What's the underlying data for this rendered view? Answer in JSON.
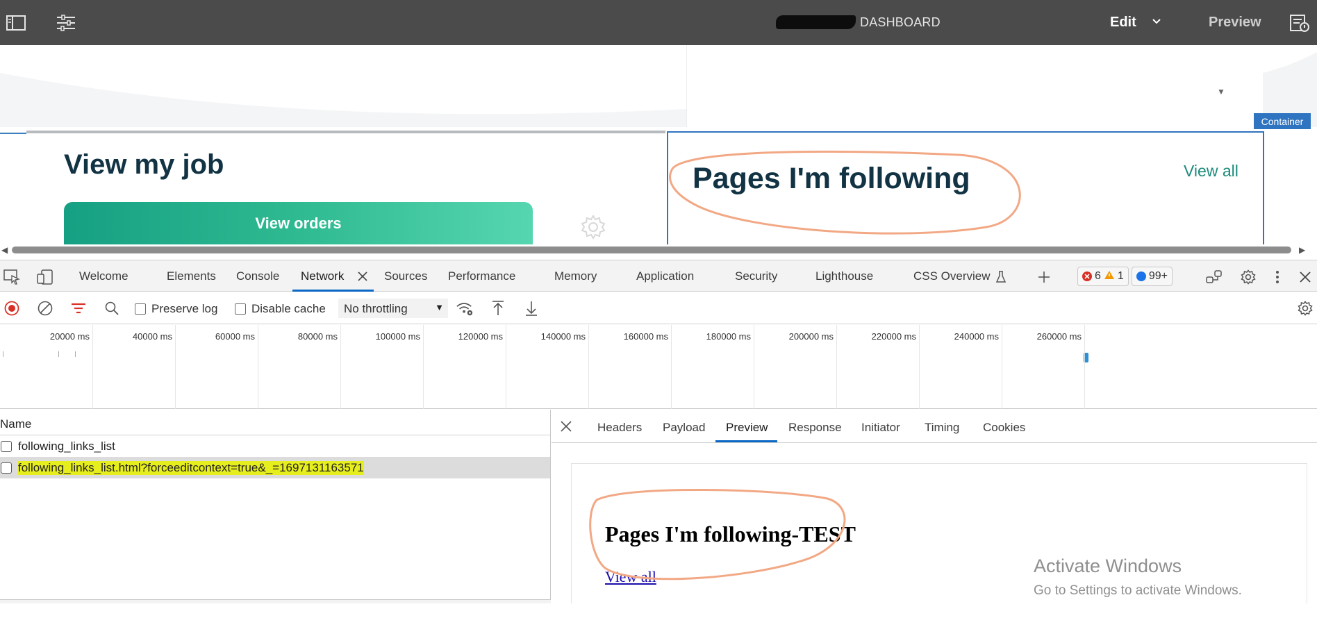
{
  "topbar": {
    "title": "DASHBOARD",
    "edit_label": "Edit",
    "preview_label": "Preview",
    "icons": [
      "sidebar-panel-icon",
      "properties-sliders-icon",
      "chevron-down-icon",
      "page-info-icon"
    ]
  },
  "page": {
    "container_badge": "Container",
    "job_title": "View my job",
    "orders_button": "View orders",
    "pages_title": "Pages I'm following",
    "view_all": "View all",
    "brand_color": "#1fa888",
    "title_color": "#123344",
    "annotation_color": "#f2a884"
  },
  "devtools": {
    "tabs": [
      {
        "label": "Welcome"
      },
      {
        "label": "Elements"
      },
      {
        "label": "Console"
      },
      {
        "label": "Network",
        "active": true
      },
      {
        "label": "Sources"
      },
      {
        "label": "Performance"
      },
      {
        "label": "Memory"
      },
      {
        "label": "Application"
      },
      {
        "label": "Security"
      },
      {
        "label": "Lighthouse"
      },
      {
        "label": "CSS Overview"
      }
    ],
    "errors": "6",
    "warnings": "1",
    "messages": "99+",
    "accent": "#0b67c5"
  },
  "network": {
    "preserve_log": "Preserve log",
    "disable_cache": "Disable cache",
    "throttling": "No throttling",
    "preserve_log_checked": false,
    "disable_cache_checked": false
  },
  "timeline": {
    "ticks": [
      "20000 ms",
      "40000 ms",
      "60000 ms",
      "80000 ms",
      "100000 ms",
      "120000 ms",
      "140000 ms",
      "160000 ms",
      "180000 ms",
      "200000 ms",
      "220000 ms",
      "240000 ms",
      "260000 ms"
    ]
  },
  "requests": {
    "column_name": "Name",
    "rows": [
      {
        "name": "following_links_list",
        "selected": false
      },
      {
        "name": "following_links_list.html?forceeditcontext=true&_=1697131163571",
        "selected": true
      }
    ]
  },
  "detail": {
    "tabs": [
      {
        "label": "Headers"
      },
      {
        "label": "Payload"
      },
      {
        "label": "Preview",
        "active": true
      },
      {
        "label": "Response"
      },
      {
        "label": "Initiator"
      },
      {
        "label": "Timing"
      },
      {
        "label": "Cookies"
      }
    ],
    "preview_heading": "Pages I'm following-TEST",
    "preview_link": "View all"
  },
  "watermark": {
    "line1": "Activate Windows",
    "line2": "Go to Settings to activate Windows."
  }
}
